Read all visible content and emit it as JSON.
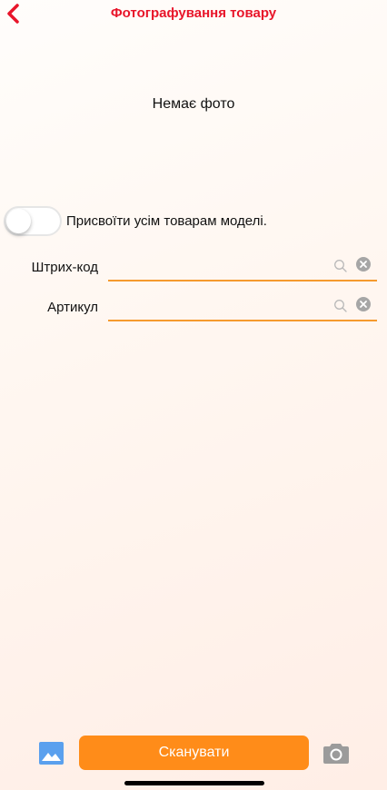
{
  "header": {
    "title": "Фотографування товару",
    "back_icon": "chevron-left-icon",
    "accent": "#e8152a"
  },
  "photo": {
    "empty_text": "Немає фото"
  },
  "assign_toggle": {
    "label": "Присвоїти усім товарам моделі.",
    "checked": false
  },
  "fields": [
    {
      "label": "Штрих-код",
      "value": "",
      "placeholder": "",
      "search_icon": "search-icon",
      "clear_icon": "clear-icon"
    },
    {
      "label": "Артикул",
      "value": "",
      "placeholder": "",
      "search_icon": "search-icon",
      "clear_icon": "clear-icon"
    }
  ],
  "bottom_bar": {
    "scan_label": "Сканувати",
    "scan_color": "#ff8c19",
    "gallery_icon": "gallery-icon",
    "camera_icon": "camera-icon"
  },
  "colors": {
    "field_underline": "#f59a2e",
    "gallery_icon": "#5aa0ee",
    "camera_icon": "#9b9b9b"
  }
}
